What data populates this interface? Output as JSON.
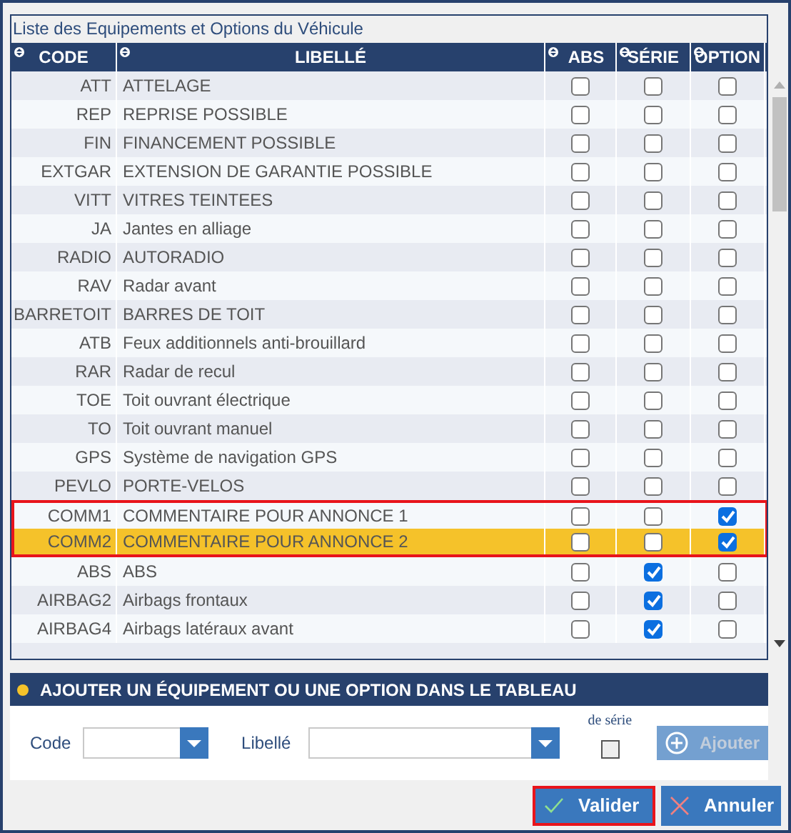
{
  "table": {
    "title": "Liste des Equipements et Options du Véhicule",
    "columns": [
      "CODE",
      "LIBELLÉ",
      "ABS",
      "SÉRIE",
      "OPTION"
    ],
    "rows": [
      {
        "code": "ATT",
        "label": "ATTELAGE",
        "abs": false,
        "serie": false,
        "option": false,
        "highlighted": false,
        "selected": false
      },
      {
        "code": "REP",
        "label": "REPRISE POSSIBLE",
        "abs": false,
        "serie": false,
        "option": false,
        "highlighted": false,
        "selected": false
      },
      {
        "code": "FIN",
        "label": "FINANCEMENT POSSIBLE",
        "abs": false,
        "serie": false,
        "option": false,
        "highlighted": false,
        "selected": false
      },
      {
        "code": "EXTGAR",
        "label": "EXTENSION DE GARANTIE POSSIBLE",
        "abs": false,
        "serie": false,
        "option": false,
        "highlighted": false,
        "selected": false
      },
      {
        "code": "VITT",
        "label": "VITRES TEINTEES",
        "abs": false,
        "serie": false,
        "option": false,
        "highlighted": false,
        "selected": false
      },
      {
        "code": "JA",
        "label": "Jantes en alliage",
        "abs": false,
        "serie": false,
        "option": false,
        "highlighted": false,
        "selected": false
      },
      {
        "code": "RADIO",
        "label": "AUTORADIO",
        "abs": false,
        "serie": false,
        "option": false,
        "highlighted": false,
        "selected": false
      },
      {
        "code": "RAV",
        "label": "Radar avant",
        "abs": false,
        "serie": false,
        "option": false,
        "highlighted": false,
        "selected": false
      },
      {
        "code": "BARRETOIT",
        "label": "BARRES DE TOIT",
        "abs": false,
        "serie": false,
        "option": false,
        "highlighted": false,
        "selected": false
      },
      {
        "code": "ATB",
        "label": "Feux additionnels anti-brouillard",
        "abs": false,
        "serie": false,
        "option": false,
        "highlighted": false,
        "selected": false
      },
      {
        "code": "RAR",
        "label": "Radar de recul",
        "abs": false,
        "serie": false,
        "option": false,
        "highlighted": false,
        "selected": false
      },
      {
        "code": "TOE",
        "label": "Toit ouvrant électrique",
        "abs": false,
        "serie": false,
        "option": false,
        "highlighted": false,
        "selected": false
      },
      {
        "code": "TO",
        "label": "Toit ouvrant manuel",
        "abs": false,
        "serie": false,
        "option": false,
        "highlighted": false,
        "selected": false
      },
      {
        "code": "GPS",
        "label": "Système de navigation GPS",
        "abs": false,
        "serie": false,
        "option": false,
        "highlighted": false,
        "selected": false
      },
      {
        "code": "PEVLO",
        "label": "PORTE-VELOS",
        "abs": false,
        "serie": false,
        "option": false,
        "highlighted": false,
        "selected": false
      },
      {
        "code": "COMM1",
        "label": "COMMENTAIRE POUR ANNONCE 1",
        "abs": false,
        "serie": false,
        "option": true,
        "highlighted": true,
        "selected": false
      },
      {
        "code": "COMM2",
        "label": "COMMENTAIRE POUR ANNONCE 2",
        "abs": false,
        "serie": false,
        "option": true,
        "highlighted": true,
        "selected": true
      },
      {
        "code": "ABS",
        "label": "ABS",
        "abs": false,
        "serie": true,
        "option": false,
        "highlighted": false,
        "selected": false
      },
      {
        "code": "AIRBAG2",
        "label": "Airbags frontaux",
        "abs": false,
        "serie": true,
        "option": false,
        "highlighted": false,
        "selected": false
      },
      {
        "code": "AIRBAG4",
        "label": "Airbags latéraux avant",
        "abs": false,
        "serie": true,
        "option": false,
        "highlighted": false,
        "selected": false
      }
    ]
  },
  "add_section": {
    "title": "AJOUTER UN ÉQUIPEMENT OU UNE OPTION DANS LE TABLEAU",
    "code_label": "Code",
    "libelle_label": "Libellé",
    "serie_label": "de série",
    "serie_checked": false,
    "add_button": {
      "label": "Ajouter",
      "disabled": true
    }
  },
  "buttons": [
    {
      "kind": "ok",
      "label": "Valider",
      "focused": true
    },
    {
      "kind": "cancel",
      "label": "Annuler",
      "focused": false
    }
  ]
}
